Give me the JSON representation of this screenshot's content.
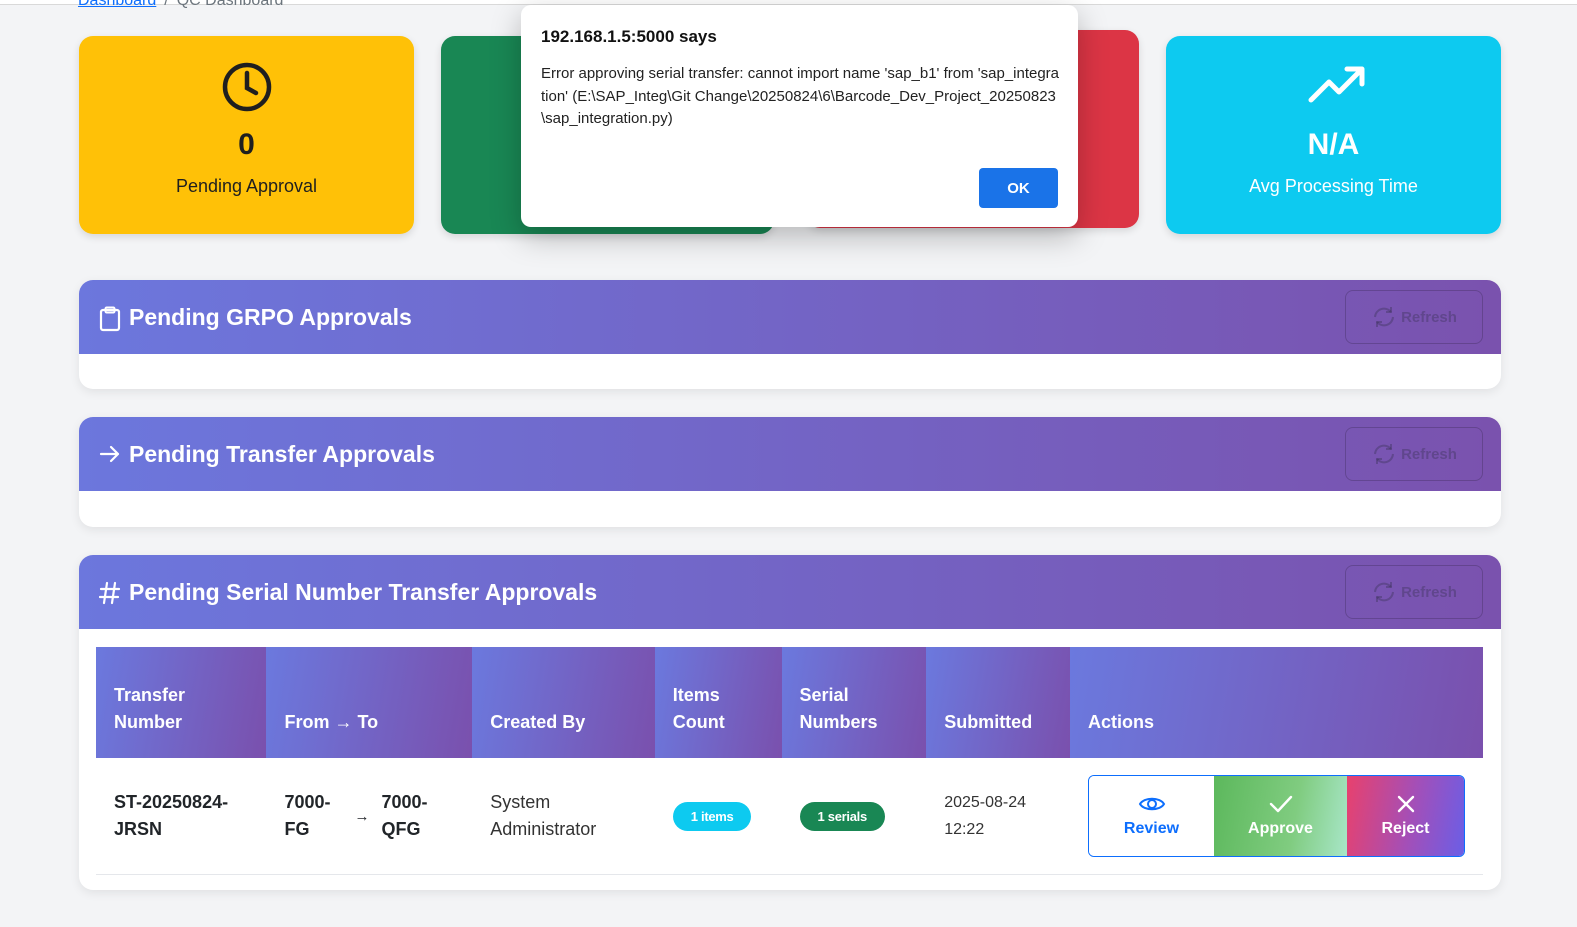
{
  "breadcrumb": {
    "link": "Dashboard",
    "separator": "/",
    "current": "QC Dashboard"
  },
  "stats": [
    {
      "icon": "clock-icon",
      "value": "0",
      "label": "Pending Approval",
      "color": "#ffc107"
    },
    {
      "icon": "check-icon",
      "value": "",
      "label": "",
      "color": "#198754"
    },
    {
      "icon": "x-icon",
      "value": "",
      "label": "",
      "color": "#dc3545"
    },
    {
      "icon": "trending-up-icon",
      "value": "N/A",
      "label": "Avg Processing Time",
      "color": "#0dcaf0"
    }
  ],
  "sections": {
    "grpo": {
      "icon": "clipboard-icon",
      "title": "Pending GRPO Approvals",
      "refresh": "Refresh"
    },
    "transfer": {
      "icon": "arrow-right-icon",
      "title": "Pending Transfer Approvals",
      "refresh": "Refresh"
    },
    "serial": {
      "icon": "hash-icon",
      "title": "Pending Serial Number Transfer Approvals",
      "refresh": "Refresh"
    }
  },
  "serial_table": {
    "headers": [
      "Transfer Number",
      "From → To",
      "Created By",
      "Items Count",
      "Serial Numbers",
      "Submitted",
      "Actions"
    ],
    "rows": [
      {
        "transfer_number": "ST-20250824-JRSN",
        "from": "7000-FG",
        "to": "7000-QFG",
        "created_by": "System Administrator",
        "items": "1 items",
        "serials": "1 serials",
        "submitted": "2025-08-24 12:22",
        "review": "Review",
        "approve": "Approve",
        "reject": "Reject"
      }
    ]
  },
  "dialog": {
    "title": "192.168.1.5:5000 says",
    "message": "Error approving serial transfer: cannot import name 'sap_b1' from 'sap_integration' (E:\\SAP_Integ\\Git Change\\20250824\\6\\Barcode_Dev_Project_20250823\\sap_integration.py)",
    "ok": "OK"
  },
  "colors": {
    "accent": "#0d6efd",
    "header_gradient_start": "#6c77dd",
    "header_gradient_end": "#7a52ae"
  }
}
